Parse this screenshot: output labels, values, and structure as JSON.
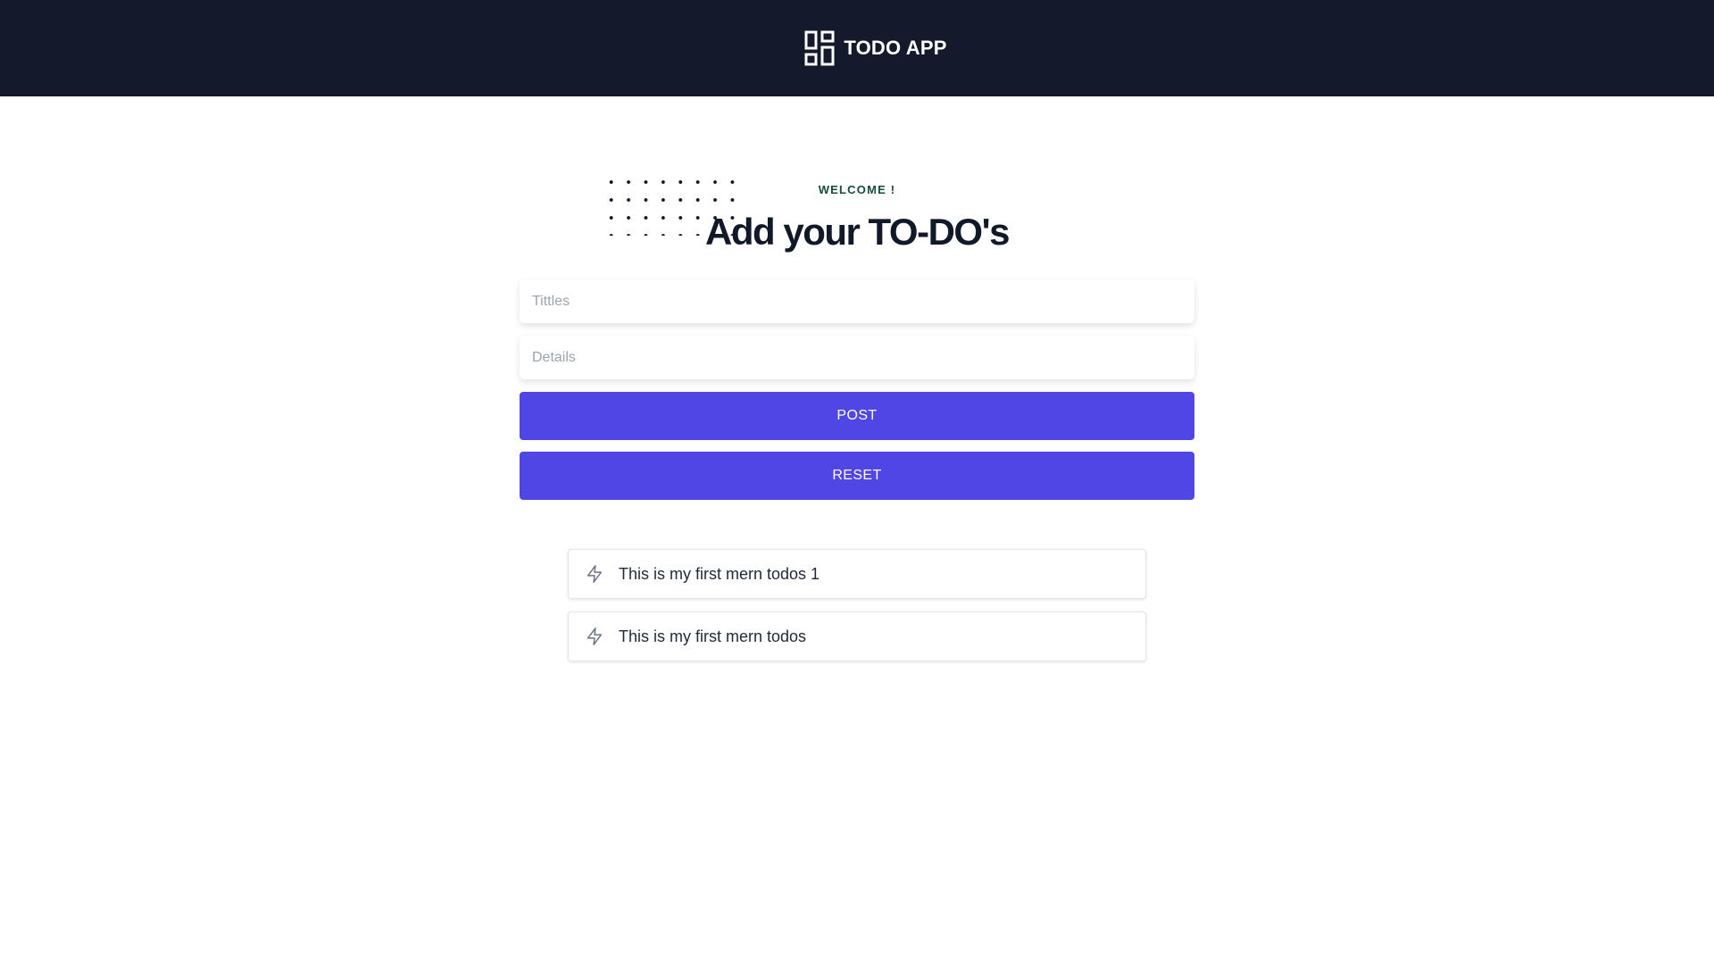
{
  "header": {
    "app_title": "TODO APP",
    "icon": "dashboard-layout-icon"
  },
  "hero": {
    "welcome": "WELCOME !",
    "title": "Add your TO-DO's"
  },
  "form": {
    "title_placeholder": "Tittles",
    "title_value": "",
    "details_placeholder": "Details",
    "details_value": "",
    "post_label": "POST",
    "reset_label": "RESET"
  },
  "todos": [
    {
      "icon": "lightning-icon",
      "text": "This is my first mern todos 1"
    },
    {
      "icon": "lightning-icon",
      "text": "This is my first mern todos"
    }
  ],
  "colors": {
    "header_bg": "#141a2b",
    "accent": "#4f46e5",
    "welcome": "#134e3a"
  }
}
